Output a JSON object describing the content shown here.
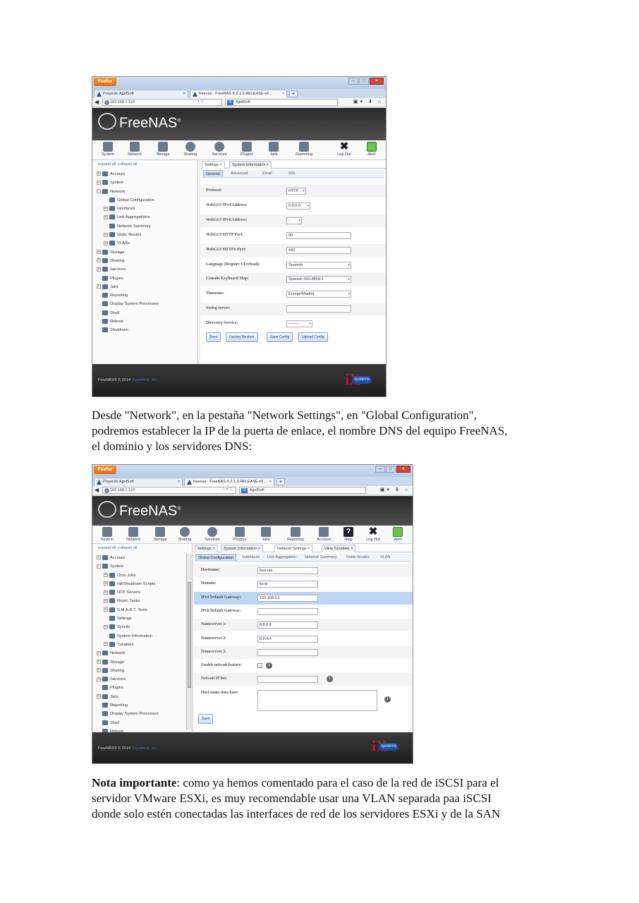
{
  "shot1": {
    "browser": {
      "app_button": "Firefox",
      "tab1": "Proyecto AjpdSoft",
      "tab2": "freenas - FreeNAS-9.2.1.3-RELEASE-x6...",
      "url": "192.168.1.119",
      "search": "AjpdSoft"
    },
    "brand": "FreeNAS",
    "toolbar": [
      "System",
      "Network",
      "Storage",
      "Sharing",
      "Services",
      "Plugins",
      "Jails",
      "Reporting",
      "Log Out",
      "Alert"
    ],
    "expand_all": "expand all",
    "collapse_all": "collapse all",
    "tree": [
      "Account",
      "System",
      "Network",
      "Global Configuration",
      "Interfaces",
      "Link Aggregations",
      "Network Summary",
      "Static Routes",
      "VLANs",
      "Storage",
      "Sharing",
      "Services",
      "Plugins",
      "Jails",
      "Reporting",
      "Display System Processes",
      "Shell",
      "Reboot",
      "Shutdown"
    ],
    "content_tabs": [
      "Settings",
      "System Information"
    ],
    "sub_tabs": [
      "General",
      "Advanced",
      "Email",
      "SSL"
    ],
    "fields": [
      {
        "label": "Protocol:",
        "value": "HTTP"
      },
      {
        "label": "WebGUI IPv4 Address:",
        "value": "0.0.0.0"
      },
      {
        "label": "WebGUI IPv6 Address:",
        "value": "::"
      },
      {
        "label": "WebGUI HTTP Port:",
        "value": "80"
      },
      {
        "label": "WebGUI HTTPS Port:",
        "value": "443"
      },
      {
        "label": "Language (Require UI reload):",
        "value": "Spanish"
      },
      {
        "label": "Console Keyboard Map:",
        "value": "Spanish ISO-8859-1"
      },
      {
        "label": "Timezone:",
        "value": "Europe/Madrid"
      },
      {
        "label": "Syslog server:",
        "value": ""
      },
      {
        "label": "Directory Service:",
        "value": "---------"
      }
    ],
    "buttons": [
      "Save",
      "Factory Restore",
      "Save Config",
      "Upload Config"
    ],
    "footer": {
      "copyright": "FreeNAS® © 2014 ",
      "company": "iXsystems, Inc."
    },
    "ix_logo": "systems"
  },
  "paragraph1": [
    "Desde \"Network\", en la pestaña \"Network Settings\", en \"Global Configuration\",",
    "podremos establecer la IP de la puerta de enlace, el nombre DNS del equipo FreeNAS,",
    "el dominio y los servidores DNS:"
  ],
  "shot2": {
    "browser": {
      "app_button": "Firefox",
      "tab1": "Proyecto AjpdSoft",
      "tab2": "freenas - FreeNAS-9.2.1.3-RELEASE-x6...",
      "url": "192.168.1.119",
      "search": "AjpdSoft"
    },
    "brand": "FreeNAS",
    "toolbar": [
      "System",
      "Network",
      "Storage",
      "Sharing",
      "Services",
      "Plugins",
      "Jails",
      "Reporting",
      "Account",
      "Help",
      "Log Out",
      "Alert"
    ],
    "expand_all": "expand all",
    "collapse_all": "collapse all",
    "tree": [
      "Account",
      "System",
      "Cron Jobs",
      "Init/Shutdown Scripts",
      "NTP Servers",
      "Rsync Tasks",
      "S.M.A.R.T. Tests",
      "Settings",
      "Sysctls",
      "System Information",
      "Tunables",
      "Network",
      "Storage",
      "Sharing",
      "Services",
      "Plugins",
      "Jails",
      "Reporting",
      "Display System Processes",
      "Shell",
      "Reboot"
    ],
    "content_tabs": [
      "Settings",
      "System Information",
      "Network Settings",
      "View Tunables"
    ],
    "sub_tabs": [
      "Global Configuration",
      "Interfaces",
      "Link Aggregation",
      "Network Summary",
      "Static Routes",
      "VLAN"
    ],
    "fields": [
      {
        "label": "Hostname:",
        "value": "freenas"
      },
      {
        "label": "Domain:",
        "value": "local"
      },
      {
        "label": "IPv4 Default Gateway:",
        "value": "192.168.1.1"
      },
      {
        "label": "IPv6 Default Gateway:",
        "value": ""
      },
      {
        "label": "Nameserver 1:",
        "value": "8.8.8.8"
      },
      {
        "label": "Nameserver 2:",
        "value": "8.8.4.4"
      },
      {
        "label": "Nameserver 3:",
        "value": ""
      },
      {
        "label": "Enable netwait feature:",
        "value": ""
      },
      {
        "label": "Netwait IP list:",
        "value": ""
      },
      {
        "label": "Host name data base:",
        "value": ""
      }
    ],
    "buttons": [
      "Save"
    ],
    "footer": {
      "copyright": "FreeNAS® © 2014 ",
      "company": "iXsystems, Inc."
    },
    "ix_logo": "systems"
  },
  "paragraph2": {
    "bold": "Nota importante",
    "line1_rest": ": como ya hemos comentado para el caso de la red de iSCSI para el",
    "line2": "servidor VMware ESXi, es muy recomendable usar una VLAN separada paa iSCSI",
    "line3": "donde solo estén conectadas las interfaces de red de los servidores ESXi y de la SAN"
  }
}
